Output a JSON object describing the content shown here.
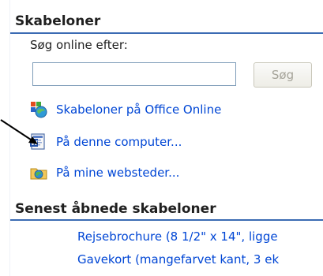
{
  "templates_section": {
    "header": "Skabeloner",
    "search_label": "Søg online efter:",
    "search_value": "",
    "search_placeholder": "",
    "search_button_label": "Søg"
  },
  "links": [
    {
      "label": "Skabeloner på Office Online",
      "icon": "office-online-icon"
    },
    {
      "label": "På denne computer...",
      "icon": "word-document-icon"
    },
    {
      "label": "På mine websteder...",
      "icon": "web-folder-icon"
    }
  ],
  "recent_section": {
    "header": "Senest åbnede skabeloner",
    "items": [
      "Rejsebrochure (8 1/2\" x 14\", ligge",
      "Gavekort (mangefarvet kant, 3 ek"
    ]
  },
  "colors": {
    "link": "#0046d5",
    "header_rule": "#3b6bb3",
    "disabled_text": "#a5a399"
  }
}
